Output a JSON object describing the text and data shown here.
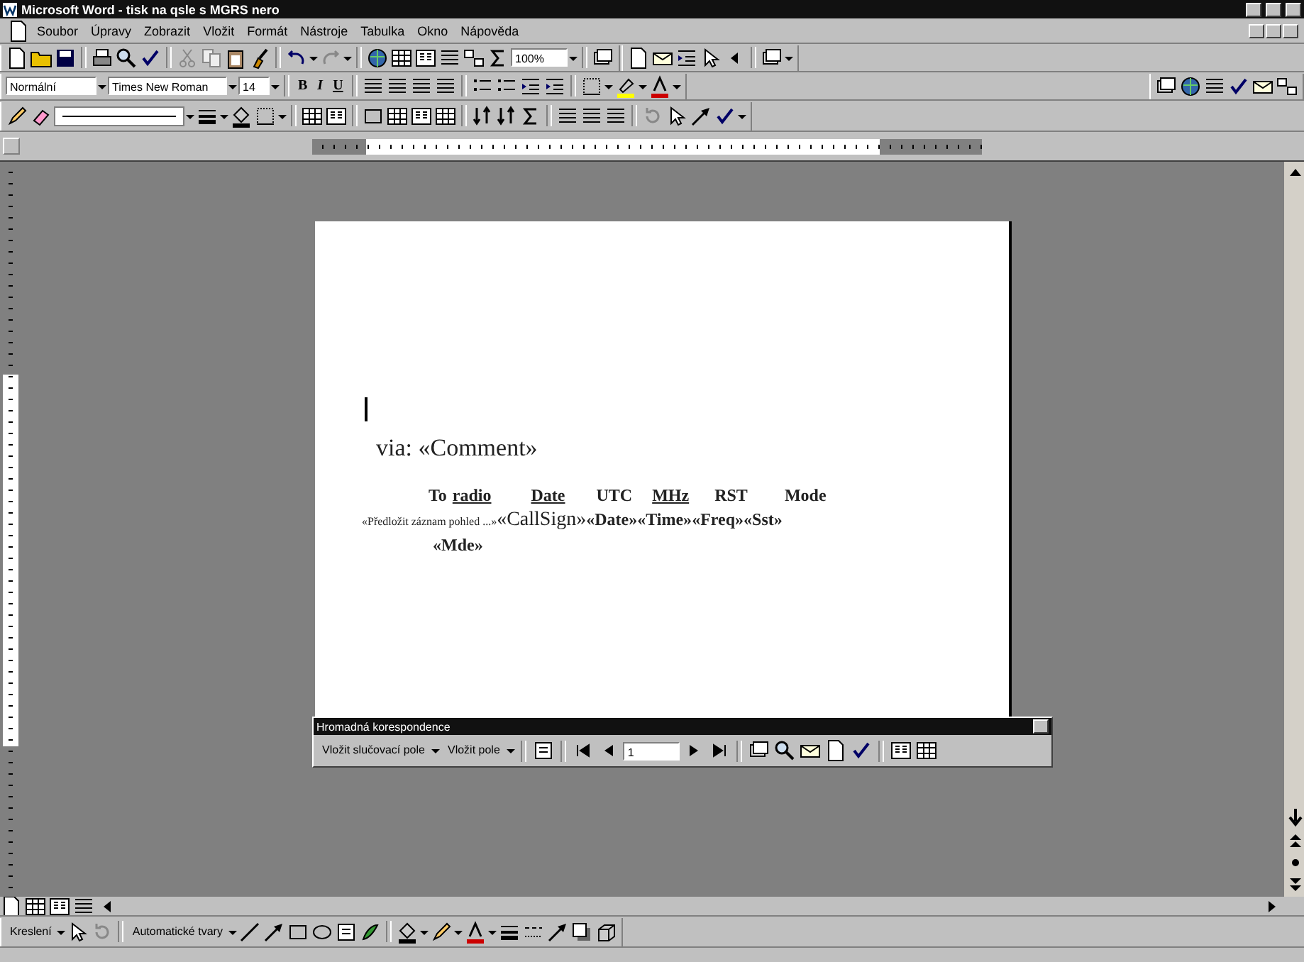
{
  "window": {
    "title": "Microsoft Word - tisk na qsle s MGRS nero"
  },
  "menu": [
    "Soubor",
    "Úpravy",
    "Zobrazit",
    "Vložit",
    "Formát",
    "Nástroje",
    "Tabulka",
    "Okno",
    "Nápověda"
  ],
  "toolbar_fields": {
    "style": "Normální",
    "font": "Times New Roman",
    "size": "14",
    "zoom": "100%"
  },
  "format_buttons": [
    "B",
    "I",
    "U"
  ],
  "document": {
    "via_line": "via: «Comment»",
    "header": [
      {
        "text": "To",
        "underlined": false
      },
      {
        "text": "radio",
        "underlined": true
      },
      {
        "text": "Date",
        "underlined": true
      },
      {
        "text": "UTC",
        "underlined": false
      },
      {
        "text": "MHz",
        "underlined": true
      },
      {
        "text": "RST",
        "underlined": false
      },
      {
        "text": "Mode",
        "underlined": false
      }
    ],
    "fields": [
      {
        "text": "«Předložit záznam pohled ...»",
        "kind": "small"
      },
      {
        "text": "«CallSign»",
        "kind": "plain"
      },
      {
        "text": "«Date»",
        "kind": "bold"
      },
      {
        "text": "«Time»",
        "kind": "bold"
      },
      {
        "text": "«Freq»",
        "kind": "bold"
      },
      {
        "text": "«Sst»",
        "kind": "bold"
      }
    ],
    "last_field": "«Mde»"
  },
  "merge_toolbar": {
    "title": "Hromadná korespondence",
    "buttons": [
      "Vložit slučovací pole",
      "Vložit pole"
    ],
    "record": "1"
  },
  "drawing_toolbar": {
    "buttons": [
      "Kreslení",
      "Automatické tvary"
    ]
  }
}
